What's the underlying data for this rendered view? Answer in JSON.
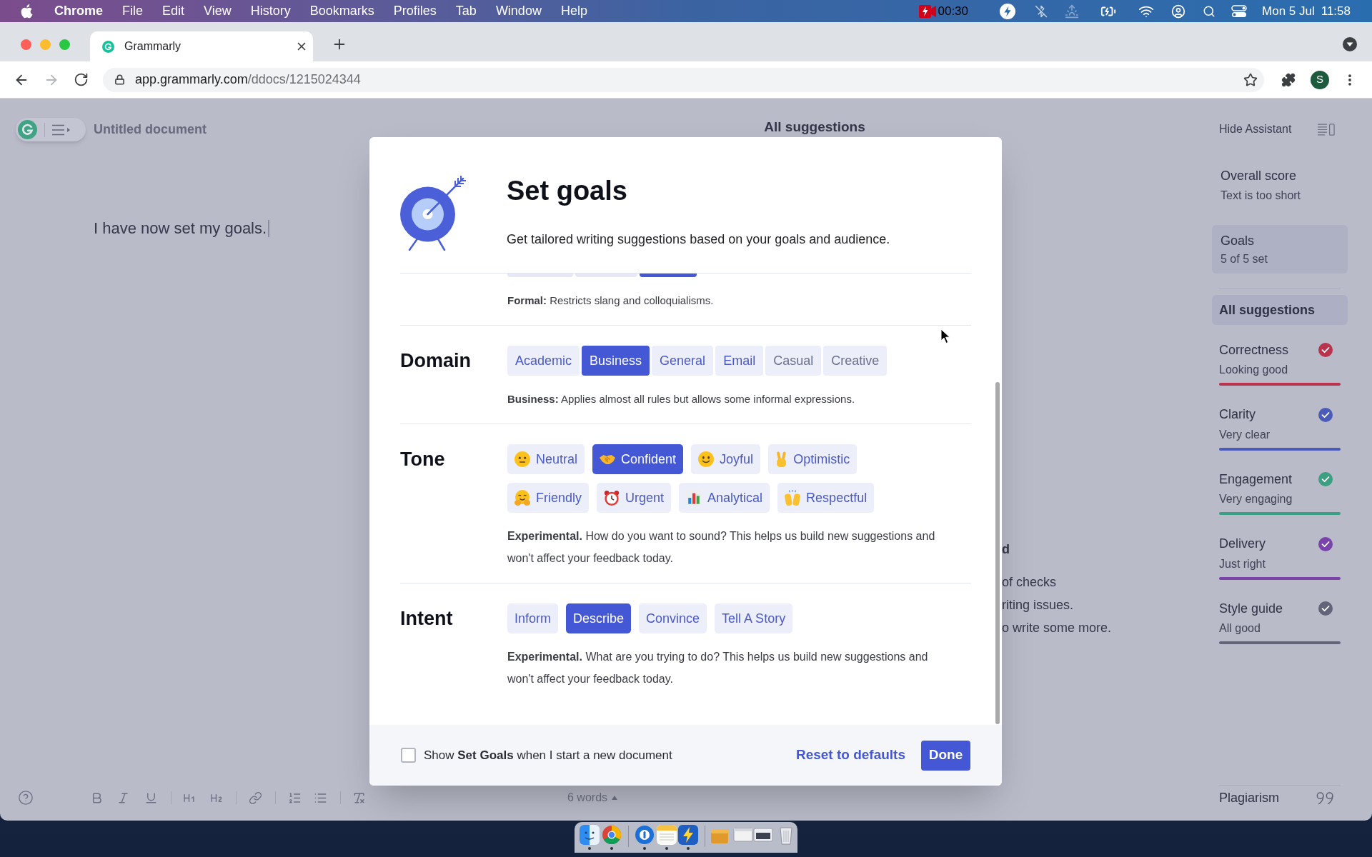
{
  "menu_bar": {
    "app": "Chrome",
    "menus": [
      "File",
      "Edit",
      "View",
      "History",
      "Bookmarks",
      "Profiles",
      "Tab",
      "Window",
      "Help"
    ],
    "recording_time": "00:30",
    "date": "Mon 5 Jul",
    "time": "11:58"
  },
  "browser": {
    "tabs": [
      {
        "title": "Grammarly",
        "selected": true
      }
    ],
    "url_host": "app.grammarly.com",
    "url_path": "/ddocs/1215024344",
    "profile_initial": "S"
  },
  "editor": {
    "title": "Untitled document",
    "text": "I have now set my goals.",
    "word_count": "6 words"
  },
  "background_panel": {
    "heading": "All suggestions",
    "fragments": [
      {
        "kind": "heading",
        "text": "d"
      },
      {
        "kind": "body",
        "text": "of checks"
      },
      {
        "kind": "body",
        "text": "riting issues."
      },
      {
        "kind": "body",
        "text": "o write some more."
      }
    ]
  },
  "assistant": {
    "hide_label": "Hide Assistant",
    "overall_score": {
      "title": "Overall score",
      "status": "Text is too short"
    },
    "goals": {
      "title": "Goals",
      "status": "5 of 5 set"
    },
    "all_suggestions": {
      "label": "All suggestions",
      "selected": true
    },
    "categories": [
      {
        "name": "Correctness",
        "status": "Looking good",
        "color": "#b9334f"
      },
      {
        "name": "Clarity",
        "status": "Very clear",
        "color": "#4a5cb8"
      },
      {
        "name": "Engagement",
        "status": "Very engaging",
        "color": "#3c9f82"
      },
      {
        "name": "Delivery",
        "status": "Just right",
        "color": "#7a43aa"
      },
      {
        "name": "Style guide",
        "status": "All good",
        "color": "#62657a"
      }
    ],
    "plagiarism": "Plagiarism"
  },
  "dialog": {
    "title": "Set goals",
    "subtitle": "Get tailored writing suggestions based on your goals and audience.",
    "sections": [
      {
        "kind": "clipped",
        "options": [
          {
            "selected": false
          },
          {
            "selected": false
          },
          {
            "selected": true
          }
        ],
        "note": "**Formal:** Restricts slang and colloquialisms."
      },
      {
        "kind": "segmented",
        "label": "Domain",
        "options": [
          {
            "label": "Academic",
            "selected": false,
            "disabled": false
          },
          {
            "label": "Business",
            "selected": true,
            "disabled": false
          },
          {
            "label": "General",
            "selected": false,
            "disabled": false
          },
          {
            "label": "Email",
            "selected": false,
            "disabled": false
          },
          {
            "label": "Casual",
            "selected": false,
            "disabled": true
          },
          {
            "label": "Creative",
            "selected": false,
            "disabled": true
          }
        ],
        "note": "**Business:** Applies almost all rules but allows some informal expressions."
      },
      {
        "kind": "emoji",
        "label": "Tone",
        "options": [
          {
            "label": "Neutral",
            "selected": false
          },
          {
            "label": "Confident",
            "selected": true
          },
          {
            "label": "Joyful",
            "selected": false
          },
          {
            "label": "Optimistic",
            "selected": false
          },
          {
            "label": "Friendly",
            "selected": false
          },
          {
            "label": "Urgent",
            "selected": false
          },
          {
            "label": "Analytical",
            "selected": false
          },
          {
            "label": "Respectful",
            "selected": false
          }
        ],
        "note": "**Experimental.** How do you want to sound? This helps us build new suggestions and won't affect your feedback today."
      },
      {
        "kind": "plain",
        "label": "Intent",
        "options": [
          {
            "label": "Inform",
            "selected": false
          },
          {
            "label": "Describe",
            "selected": true
          },
          {
            "label": "Convince",
            "selected": false
          },
          {
            "label": "Tell A Story",
            "selected": false
          }
        ],
        "note": "**Experimental.** What are you trying to do? This helps us build new suggestions and won't affect your feedback today."
      }
    ],
    "footer": {
      "checkbox_label": "Show **Set Goals** when I start a new document",
      "checked": false,
      "reset": "Reset to defaults",
      "done": "Done"
    }
  }
}
